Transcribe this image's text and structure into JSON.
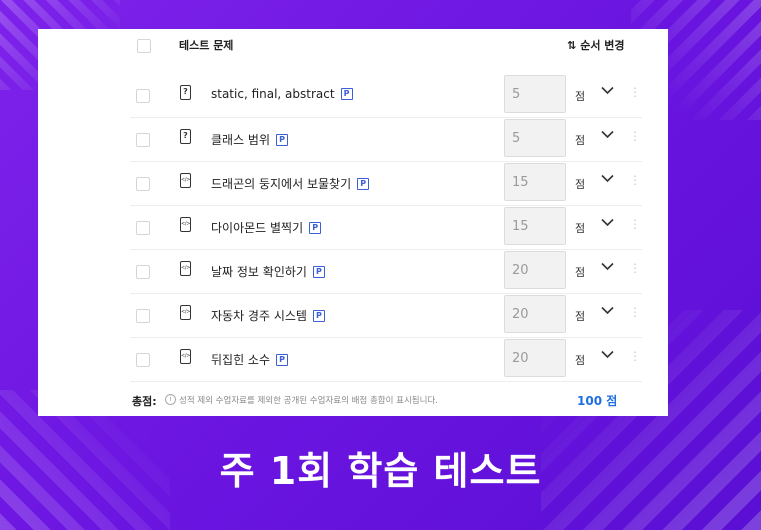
{
  "header": {
    "title": "테스트 문제",
    "sort_icon": "sort-arrows-icon",
    "sort_label": "순서 변경"
  },
  "rows": [
    {
      "icon": "?",
      "icon_type": "quiz-icon",
      "title": "static, final, abstract",
      "score": "5",
      "unit": "점"
    },
    {
      "icon": "?",
      "icon_type": "quiz-icon",
      "title": "클래스 범위",
      "score": "5",
      "unit": "점"
    },
    {
      "icon": "</>",
      "icon_type": "code-icon",
      "title": "드래곤의 둥지에서 보물찾기",
      "score": "15",
      "unit": "점"
    },
    {
      "icon": "</>",
      "icon_type": "code-icon",
      "title": "다이아몬드 별찍기",
      "score": "15",
      "unit": "점"
    },
    {
      "icon": "</>",
      "icon_type": "code-icon",
      "title": "날짜 정보 확인하기",
      "score": "20",
      "unit": "점"
    },
    {
      "icon": "</>",
      "icon_type": "code-icon",
      "title": "자동차 경주 시스템",
      "score": "20",
      "unit": "점"
    },
    {
      "icon": "</>",
      "icon_type": "code-icon",
      "title": "뒤집힌 소수",
      "score": "20",
      "unit": "점"
    }
  ],
  "badge": "P",
  "footer": {
    "total_label": "총점:",
    "note": "성적 제외 수업자료를 제외한 공개된 수업자료의 배점 총합이 표시됩니다.",
    "total_value": "100 점"
  },
  "banner": {
    "title": "주 1회 학습 테스트"
  },
  "colors": {
    "background": "#6a14e0",
    "accent": "#1f6fe0",
    "badge": "#3d5fd6"
  }
}
